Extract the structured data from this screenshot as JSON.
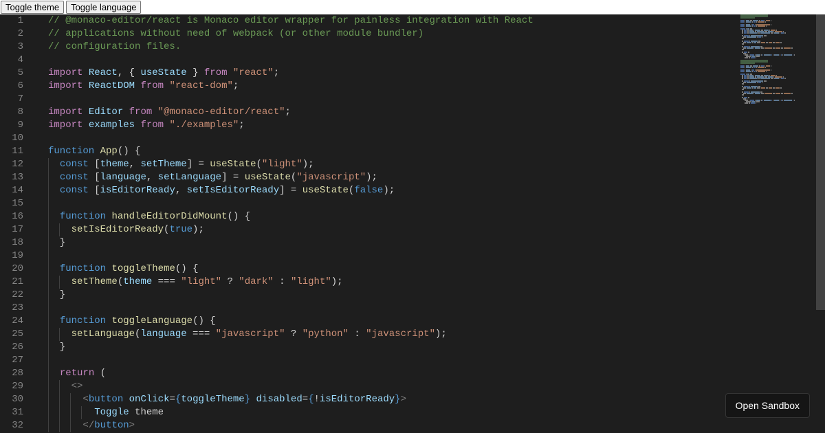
{
  "topbar": {
    "toggle_theme": "Toggle theme",
    "toggle_language": "Toggle language"
  },
  "footer": {
    "open_sandbox": "Open Sandbox"
  },
  "editor": {
    "line_start": 1,
    "line_end": 32,
    "lines": [
      {
        "n": 1,
        "indent": 0,
        "tokens": [
          [
            "cm",
            "// @monaco-editor/react is Monaco editor wrapper for painless integration with React"
          ]
        ]
      },
      {
        "n": 2,
        "indent": 0,
        "tokens": [
          [
            "cm",
            "// applications without need of webpack (or other module bundler)"
          ]
        ]
      },
      {
        "n": 3,
        "indent": 0,
        "tokens": [
          [
            "cm",
            "// configuration files."
          ]
        ]
      },
      {
        "n": 4,
        "indent": 0,
        "tokens": []
      },
      {
        "n": 5,
        "indent": 0,
        "tokens": [
          [
            "kw2",
            "import"
          ],
          [
            "pu",
            " "
          ],
          [
            "id",
            "React"
          ],
          [
            "pu",
            ", { "
          ],
          [
            "id",
            "useState"
          ],
          [
            "pu",
            " } "
          ],
          [
            "kw2",
            "from"
          ],
          [
            "pu",
            " "
          ],
          [
            "st",
            "\"react\""
          ],
          [
            "pu",
            ";"
          ]
        ]
      },
      {
        "n": 6,
        "indent": 0,
        "tokens": [
          [
            "kw2",
            "import"
          ],
          [
            "pu",
            " "
          ],
          [
            "id",
            "ReactDOM"
          ],
          [
            "pu",
            " "
          ],
          [
            "kw2",
            "from"
          ],
          [
            "pu",
            " "
          ],
          [
            "st",
            "\"react-dom\""
          ],
          [
            "pu",
            ";"
          ]
        ]
      },
      {
        "n": 7,
        "indent": 0,
        "tokens": []
      },
      {
        "n": 8,
        "indent": 0,
        "tokens": [
          [
            "kw2",
            "import"
          ],
          [
            "pu",
            " "
          ],
          [
            "id",
            "Editor"
          ],
          [
            "pu",
            " "
          ],
          [
            "kw2",
            "from"
          ],
          [
            "pu",
            " "
          ],
          [
            "st",
            "\"@monaco-editor/react\""
          ],
          [
            "pu",
            ";"
          ]
        ]
      },
      {
        "n": 9,
        "indent": 0,
        "tokens": [
          [
            "kw2",
            "import"
          ],
          [
            "pu",
            " "
          ],
          [
            "id",
            "examples"
          ],
          [
            "pu",
            " "
          ],
          [
            "kw2",
            "from"
          ],
          [
            "pu",
            " "
          ],
          [
            "st",
            "\"./examples\""
          ],
          [
            "pu",
            ";"
          ]
        ]
      },
      {
        "n": 10,
        "indent": 0,
        "tokens": []
      },
      {
        "n": 11,
        "indent": 0,
        "tokens": [
          [
            "kw",
            "function"
          ],
          [
            "pu",
            " "
          ],
          [
            "fn",
            "App"
          ],
          [
            "pu",
            "() {"
          ]
        ]
      },
      {
        "n": 12,
        "indent": 1,
        "tokens": [
          [
            "pu",
            "  "
          ],
          [
            "kw",
            "const"
          ],
          [
            "pu",
            " ["
          ],
          [
            "id",
            "theme"
          ],
          [
            "pu",
            ", "
          ],
          [
            "id",
            "setTheme"
          ],
          [
            "pu",
            "] = "
          ],
          [
            "fn",
            "useState"
          ],
          [
            "pu",
            "("
          ],
          [
            "st",
            "\"light\""
          ],
          [
            "pu",
            ");"
          ]
        ]
      },
      {
        "n": 13,
        "indent": 1,
        "tokens": [
          [
            "pu",
            "  "
          ],
          [
            "kw",
            "const"
          ],
          [
            "pu",
            " ["
          ],
          [
            "id",
            "language"
          ],
          [
            "pu",
            ", "
          ],
          [
            "id",
            "setLanguage"
          ],
          [
            "pu",
            "] = "
          ],
          [
            "fn",
            "useState"
          ],
          [
            "pu",
            "("
          ],
          [
            "st",
            "\"javascript\""
          ],
          [
            "pu",
            ");"
          ]
        ]
      },
      {
        "n": 14,
        "indent": 1,
        "tokens": [
          [
            "pu",
            "  "
          ],
          [
            "kw",
            "const"
          ],
          [
            "pu",
            " ["
          ],
          [
            "id",
            "isEditorReady"
          ],
          [
            "pu",
            ", "
          ],
          [
            "id",
            "setIsEditorReady"
          ],
          [
            "pu",
            "] = "
          ],
          [
            "fn",
            "useState"
          ],
          [
            "pu",
            "("
          ],
          [
            "co",
            "false"
          ],
          [
            "pu",
            ");"
          ]
        ]
      },
      {
        "n": 15,
        "indent": 1,
        "tokens": []
      },
      {
        "n": 16,
        "indent": 1,
        "tokens": [
          [
            "pu",
            "  "
          ],
          [
            "kw",
            "function"
          ],
          [
            "pu",
            " "
          ],
          [
            "fn",
            "handleEditorDidMount"
          ],
          [
            "pu",
            "() {"
          ]
        ]
      },
      {
        "n": 17,
        "indent": 2,
        "tokens": [
          [
            "pu",
            "    "
          ],
          [
            "fn",
            "setIsEditorReady"
          ],
          [
            "pu",
            "("
          ],
          [
            "co",
            "true"
          ],
          [
            "pu",
            ");"
          ]
        ]
      },
      {
        "n": 18,
        "indent": 1,
        "tokens": [
          [
            "pu",
            "  }"
          ]
        ]
      },
      {
        "n": 19,
        "indent": 1,
        "tokens": []
      },
      {
        "n": 20,
        "indent": 1,
        "tokens": [
          [
            "pu",
            "  "
          ],
          [
            "kw",
            "function"
          ],
          [
            "pu",
            " "
          ],
          [
            "fn",
            "toggleTheme"
          ],
          [
            "pu",
            "() {"
          ]
        ]
      },
      {
        "n": 21,
        "indent": 2,
        "tokens": [
          [
            "pu",
            "    "
          ],
          [
            "fn",
            "setTheme"
          ],
          [
            "pu",
            "("
          ],
          [
            "id",
            "theme"
          ],
          [
            "pu",
            " === "
          ],
          [
            "st",
            "\"light\""
          ],
          [
            "pu",
            " ? "
          ],
          [
            "st",
            "\"dark\""
          ],
          [
            "pu",
            " : "
          ],
          [
            "st",
            "\"light\""
          ],
          [
            "pu",
            ");"
          ]
        ]
      },
      {
        "n": 22,
        "indent": 1,
        "tokens": [
          [
            "pu",
            "  }"
          ]
        ]
      },
      {
        "n": 23,
        "indent": 1,
        "tokens": []
      },
      {
        "n": 24,
        "indent": 1,
        "tokens": [
          [
            "pu",
            "  "
          ],
          [
            "kw",
            "function"
          ],
          [
            "pu",
            " "
          ],
          [
            "fn",
            "toggleLanguage"
          ],
          [
            "pu",
            "() {"
          ]
        ]
      },
      {
        "n": 25,
        "indent": 2,
        "tokens": [
          [
            "pu",
            "    "
          ],
          [
            "fn",
            "setLanguage"
          ],
          [
            "pu",
            "("
          ],
          [
            "id",
            "language"
          ],
          [
            "pu",
            " === "
          ],
          [
            "st",
            "\"javascript\""
          ],
          [
            "pu",
            " ? "
          ],
          [
            "st",
            "\"python\""
          ],
          [
            "pu",
            " : "
          ],
          [
            "st",
            "\"javascript\""
          ],
          [
            "pu",
            ");"
          ]
        ]
      },
      {
        "n": 26,
        "indent": 1,
        "tokens": [
          [
            "pu",
            "  }"
          ]
        ]
      },
      {
        "n": 27,
        "indent": 1,
        "tokens": []
      },
      {
        "n": 28,
        "indent": 1,
        "tokens": [
          [
            "pu",
            "  "
          ],
          [
            "kw2",
            "return"
          ],
          [
            "pu",
            " ("
          ]
        ]
      },
      {
        "n": 29,
        "indent": 2,
        "tokens": [
          [
            "pu",
            "    "
          ],
          [
            "tag",
            "<>"
          ]
        ]
      },
      {
        "n": 30,
        "indent": 3,
        "tokens": [
          [
            "pu",
            "      "
          ],
          [
            "tag",
            "<"
          ],
          [
            "kw",
            "button"
          ],
          [
            "pu",
            " "
          ],
          [
            "attr",
            "onClick"
          ],
          [
            "pu",
            "="
          ],
          [
            "kw",
            "{"
          ],
          [
            "id",
            "toggleTheme"
          ],
          [
            "kw",
            "}"
          ],
          [
            "pu",
            " "
          ],
          [
            "attr",
            "disabled"
          ],
          [
            "pu",
            "="
          ],
          [
            "kw",
            "{"
          ],
          [
            "pu",
            "!"
          ],
          [
            "id",
            "isEditorReady"
          ],
          [
            "kw",
            "}"
          ],
          [
            "tag",
            ">"
          ]
        ]
      },
      {
        "n": 31,
        "indent": 4,
        "tokens": [
          [
            "pu",
            "        "
          ],
          [
            "id",
            "Toggle"
          ],
          [
            "pu",
            " theme"
          ]
        ]
      },
      {
        "n": 32,
        "indent": 3,
        "tokens": [
          [
            "pu",
            "      "
          ],
          [
            "tag",
            "</"
          ],
          [
            "kw",
            "button"
          ],
          [
            "tag",
            ">"
          ]
        ]
      }
    ]
  }
}
